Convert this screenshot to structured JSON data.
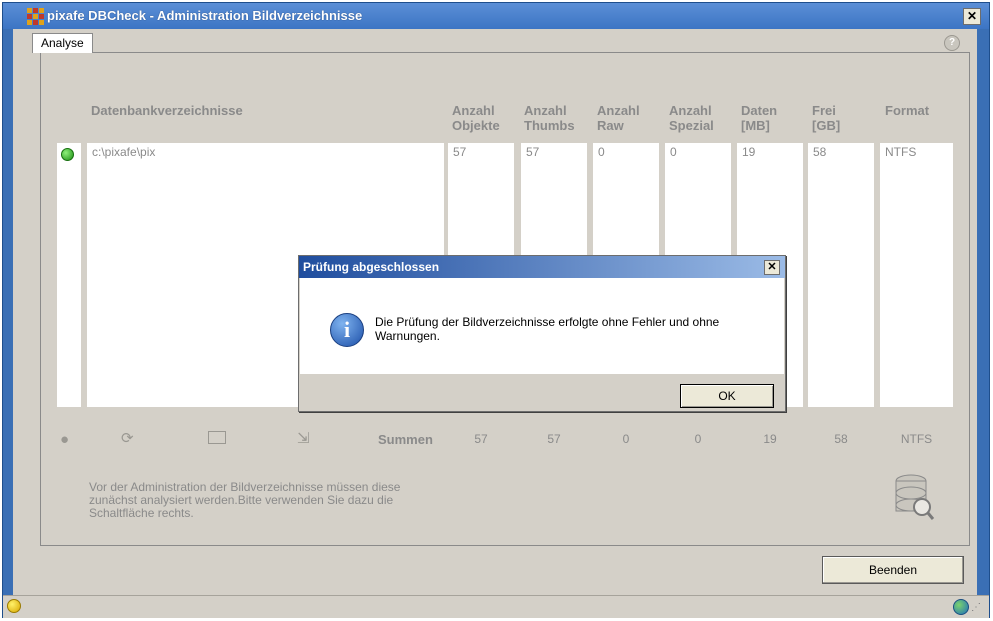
{
  "window": {
    "title": "pixafe DBCheck - Administration Bildverzeichnisse"
  },
  "tabs": [
    {
      "label": "Analyse"
    }
  ],
  "table": {
    "headers": {
      "dirs": "Datenbankverzeichnisse",
      "objects": "Anzahl\nObjekte",
      "thumbs": "Anzahl\nThumbs",
      "raw": "Anzahl\nRaw",
      "special": "Anzahl\nSpezial",
      "data": "Daten\n[MB]",
      "free": "Frei\n[GB]",
      "format": "Format"
    },
    "rows": [
      {
        "path": "c:\\pixafe\\pix",
        "objects": "57",
        "thumbs": "57",
        "raw": "0",
        "special": "0",
        "data": "19",
        "free": "58",
        "format": "NTFS"
      }
    ]
  },
  "toolbar": {
    "summen_label": "Summen"
  },
  "sums": {
    "objects": "57",
    "thumbs": "57",
    "raw": "0",
    "special": "0",
    "data": "19",
    "free": "58",
    "format": "NTFS"
  },
  "note": "Vor der Administration der Bildverzeichnisse müssen diese zunächst analysiert werden.Bitte verwenden Sie dazu die Schaltfläche rechts.",
  "buttons": {
    "beenden": "Beenden"
  },
  "dialog": {
    "title": "Prüfung abgeschlossen",
    "message": "Die Prüfung der Bildverzeichnisse erfolgte ohne Fehler und ohne Warnungen.",
    "ok": "OK"
  },
  "colors": {
    "titlebar": "#3c75c4",
    "status_ok": "#1c8c12",
    "dialog_title": "#1f4d9e"
  },
  "icons": {
    "status": "green-status-icon",
    "toolbar": [
      "status-dot-icon",
      "refresh-icon",
      "folder-icon",
      "export-icon"
    ],
    "info": "info-icon",
    "database": "database-search-icon"
  }
}
